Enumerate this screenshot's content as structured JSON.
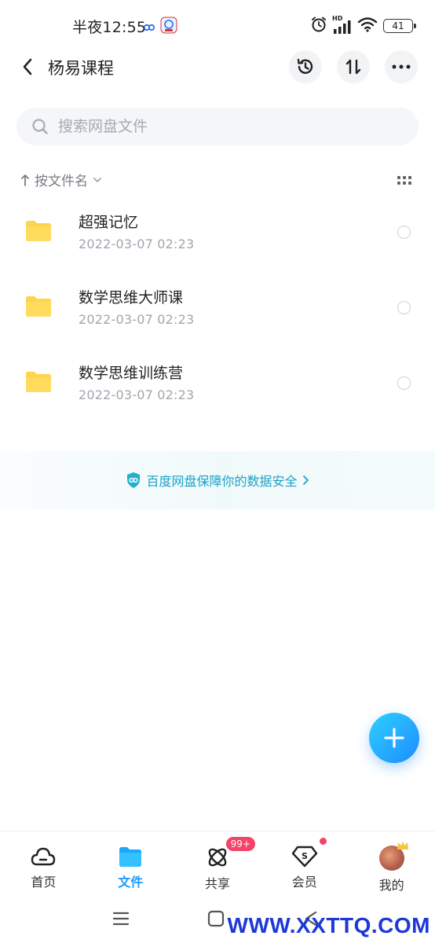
{
  "status_bar": {
    "time": "半夜12:55",
    "signal_label": "HD",
    "battery_level": "41",
    "icons": [
      "baidu-netdisk-small-icon",
      "app-notification-icon",
      "alarm-icon",
      "signal-icon",
      "wifi-icon",
      "battery-icon"
    ]
  },
  "header": {
    "title": "杨易课程",
    "back_icon": "chevron-left-icon",
    "actions": [
      "history-icon",
      "transfer-icon",
      "more-icon"
    ]
  },
  "search": {
    "placeholder": "搜索网盘文件"
  },
  "sort": {
    "label": "按文件名"
  },
  "files": [
    {
      "name": "超强记忆",
      "date": "2022-03-07  02:23"
    },
    {
      "name": "数学思维大师课",
      "date": "2022-03-07  02:23"
    },
    {
      "name": "数学思维训练营",
      "date": "2022-03-07  02:23"
    }
  ],
  "banner": {
    "text": "百度网盘保障你的数据安全"
  },
  "tabs": [
    {
      "label": "首页",
      "icon": "cloud-home-icon"
    },
    {
      "label": "文件",
      "icon": "folder-icon",
      "active": true
    },
    {
      "label": "共享",
      "icon": "share-atom-icon",
      "badge": "99+"
    },
    {
      "label": "会员",
      "icon": "vip-diamond-icon",
      "dot": true
    },
    {
      "label": "我的",
      "icon": "avatar"
    }
  ],
  "watermark": "WWW.XXTTQ.COM",
  "colors": {
    "accent": "#1a9bff",
    "folder": "#ffd34d",
    "badge": "#f3436a",
    "banner_text": "#1aa2c7"
  }
}
